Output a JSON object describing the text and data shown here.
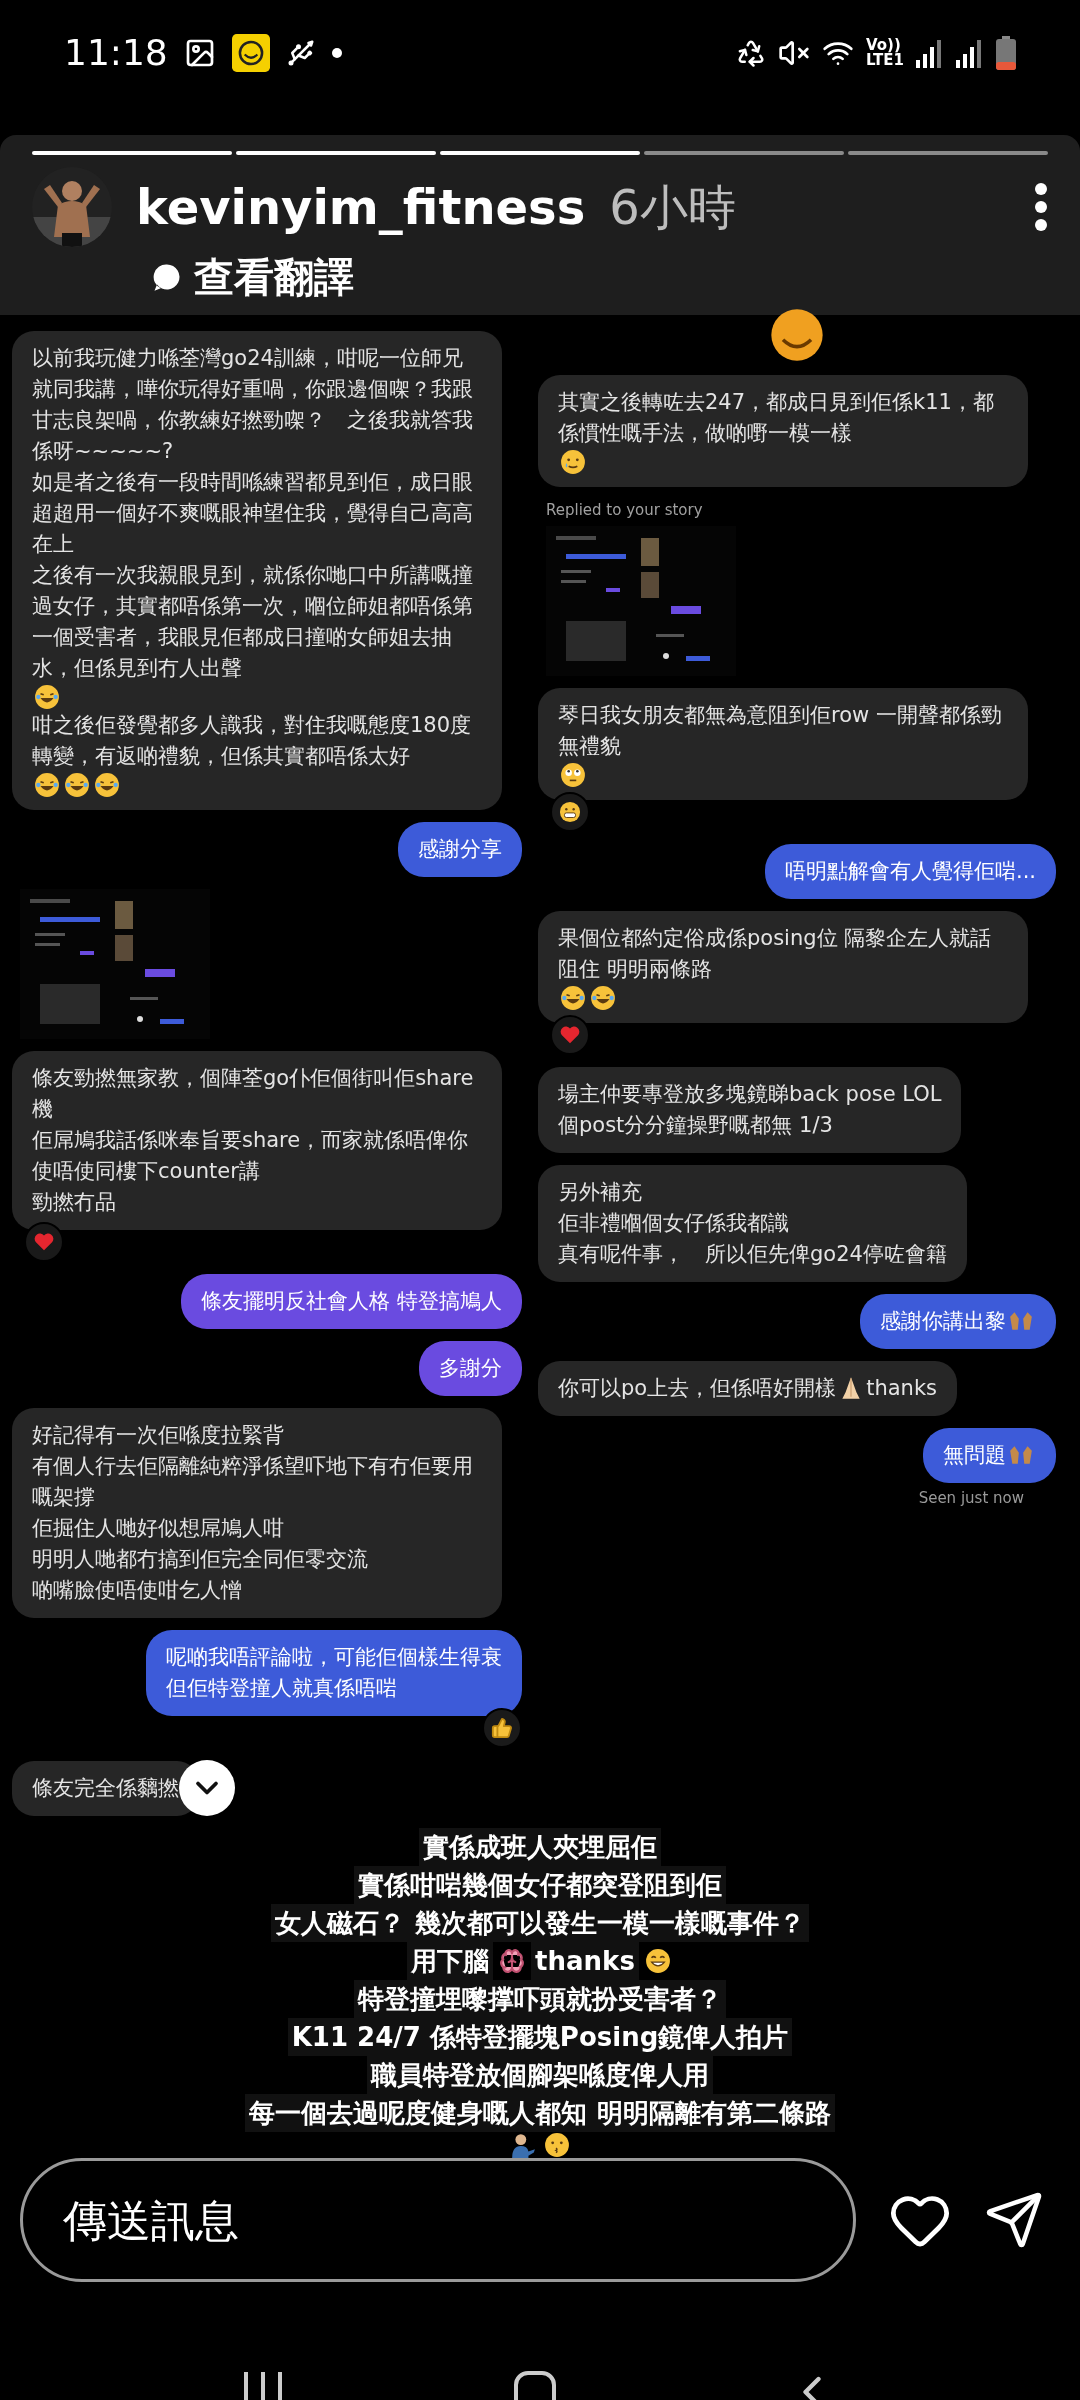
{
  "status_bar": {
    "time": "11:18",
    "network_top": "Vo))",
    "network_bottom": "LTE1"
  },
  "story": {
    "segments": [
      {
        "viewed": true
      },
      {
        "viewed": true
      },
      {
        "viewed": true
      },
      {
        "viewed": false
      },
      {
        "viewed": false
      }
    ],
    "username": "kevinyim_fitness",
    "time": "6小時",
    "translate": "查看翻譯"
  },
  "left_column": [
    {
      "kind": "message",
      "sent": false,
      "color": "#262626",
      "paragraphs": [
        [
          {
            "kind": "text",
            "text": "以前我玩健力喺荃灣go24訓練，咁呢一位師兄就同我講，嘩你玩得好重喎，你跟邊個㗎？我跟甘志良架喎，你教練好撚勁㗎？　之後我就答我係呀~~~~~?"
          }
        ],
        [
          {
            "kind": "text",
            "text": "如是者之後有一段時間喺練習都見到佢，成日眼超超用一個好不爽嘅眼神望住我，覺得自己高高在上"
          }
        ],
        [
          {
            "kind": "text",
            "text": "之後有一次我親眼見到，就係你哋口中所講嘅撞過女仔，其實都唔係第一次，嗰位師姐都唔係第一個受害者，我眼見佢都成日撞啲女師姐去抽水，但係見到冇人出聲"
          },
          {
            "kind": "laugh"
          }
        ],
        [
          {
            "kind": "text",
            "text": "咁之後佢發覺都多人識我，對住我嘅態度180度轉變，有返啲禮貌，但係其實都唔係太好"
          },
          {
            "kind": "laugh"
          },
          {
            "kind": "laugh"
          },
          {
            "kind": "laugh"
          }
        ]
      ]
    },
    {
      "kind": "message",
      "sent": true,
      "color": "#3d5bd9",
      "paragraphs": [
        [
          {
            "kind": "text",
            "text": "感謝分享"
          }
        ]
      ]
    },
    {
      "kind": "screenshot"
    },
    {
      "kind": "message",
      "sent": false,
      "color": "#262626",
      "reaction": {
        "kind": "heart"
      },
      "paragraphs": [
        [
          {
            "kind": "text",
            "text": "條友勁撚無家教，個陣荃go仆佢個街叫佢share機"
          }
        ],
        [
          {
            "kind": "text",
            "text": "佢屌鳩我話係咪奉旨要share，而家就係唔俾你使唔使同樓下counter講"
          }
        ],
        [
          {
            "kind": "text",
            "text": "勁撚冇品"
          }
        ]
      ]
    },
    {
      "kind": "message",
      "sent": true,
      "color": "#6a4be0",
      "paragraphs": [
        [
          {
            "kind": "text",
            "text": "條友擺明反社會人格 特登搞鳩人"
          }
        ]
      ]
    },
    {
      "kind": "message",
      "sent": true,
      "color": "#6a4be0",
      "paragraphs": [
        [
          {
            "kind": "text",
            "text": "多謝分"
          }
        ]
      ]
    },
    {
      "kind": "message",
      "sent": false,
      "color": "#262626",
      "paragraphs": [
        [
          {
            "kind": "text",
            "text": "好記得有一次佢喺度拉緊背"
          }
        ],
        [
          {
            "kind": "text",
            "text": "有個人行去佢隔離純粹淨係望吓地下有冇佢要用嘅架撐"
          }
        ],
        [
          {
            "kind": "text",
            "text": "佢掘住人哋好似想屌鳩人咁"
          }
        ],
        [
          {
            "kind": "text",
            "text": "明明人哋都冇搞到佢完全同佢零交流"
          }
        ],
        [
          {
            "kind": "text",
            "text": "啲嘴臉使唔使咁乞人憎"
          }
        ]
      ]
    },
    {
      "kind": "message",
      "sent": true,
      "color": "#3d5bd9",
      "reaction": {
        "kind": "thumbs"
      },
      "paragraphs": [
        [
          {
            "kind": "text",
            "text": "呢啲我唔評論啦，可能佢個樣生得衰"
          }
        ],
        [
          {
            "kind": "text",
            "text": "但佢特登撞人就真係唔啱"
          }
        ]
      ]
    },
    {
      "kind": "message",
      "sent": false,
      "color": "#262626",
      "scroll_button": true,
      "paragraphs": [
        [
          {
            "kind": "text",
            "text": "條友完全係黐撚"
          }
        ]
      ]
    }
  ],
  "right_column": [
    {
      "kind": "face"
    },
    {
      "kind": "message",
      "sent": false,
      "color": "#262626",
      "paragraphs": [
        [
          {
            "kind": "text",
            "text": "其實之後轉咗去247，都成日見到佢係k11，都係慣性嘅手法，做啲嘢一模一樣"
          },
          {
            "kind": "tear"
          }
        ]
      ]
    },
    {
      "kind": "screenshot",
      "label": "Replied to your story"
    },
    {
      "kind": "message",
      "sent": false,
      "color": "#262626",
      "reaction": {
        "kind": "grimace"
      },
      "paragraphs": [
        [
          {
            "kind": "text",
            "text": "琴日我女朋友都無為意阻到佢row 一開聲都係勁無禮貌"
          },
          {
            "kind": "eyeroll"
          }
        ]
      ]
    },
    {
      "kind": "message",
      "sent": true,
      "color": "#3d5bd9",
      "paragraphs": [
        [
          {
            "kind": "text",
            "text": "唔明點解會有人覺得佢啱..."
          }
        ]
      ]
    },
    {
      "kind": "message",
      "sent": false,
      "color": "#262626",
      "reaction": {
        "kind": "heart"
      },
      "paragraphs": [
        [
          {
            "kind": "text",
            "text": "果個位都約定俗成係posing位 隔黎企左人就話阻住 明明兩條路"
          },
          {
            "kind": "laugh"
          },
          {
            "kind": "laugh"
          }
        ]
      ]
    },
    {
      "kind": "message",
      "sent": false,
      "color": "#262626",
      "paragraphs": [
        [
          {
            "kind": "text",
            "text": "場主仲要專登放多塊鏡睇back pose LOL"
          }
        ],
        [
          {
            "kind": "text",
            "text": "個post分分鐘操野嘅都無 1/3"
          }
        ]
      ]
    },
    {
      "kind": "message",
      "sent": false,
      "color": "#262626",
      "paragraphs": [
        [
          {
            "kind": "text",
            "text": "另外補充"
          }
        ],
        [
          {
            "kind": "text",
            "text": "佢非禮嗰個女仔係我都識"
          }
        ],
        [
          {
            "kind": "text",
            "text": "真有呢件事，　所以佢先俾go24停咗會籍"
          }
        ]
      ]
    },
    {
      "kind": "message",
      "sent": true,
      "color": "#3d5bd9",
      "paragraphs": [
        [
          {
            "kind": "text",
            "text": "感謝你講出黎"
          },
          {
            "kind": "hands"
          }
        ]
      ]
    },
    {
      "kind": "message",
      "sent": false,
      "color": "#262626",
      "paragraphs": [
        [
          {
            "kind": "text",
            "text": "你可以po上去，但係唔好開樣"
          },
          {
            "kind": "pray"
          },
          {
            "kind": "text",
            "text": "thanks"
          }
        ]
      ]
    },
    {
      "kind": "message",
      "sent": true,
      "color": "#3d5bd9",
      "status": "Seen just now",
      "paragraphs": [
        [
          {
            "kind": "text",
            "text": "無問題"
          },
          {
            "kind": "hands"
          }
        ]
      ]
    }
  ],
  "caption": [
    [
      {
        "kind": "text",
        "text": "實係成班人夾埋屈佢"
      }
    ],
    [
      {
        "kind": "text",
        "text": "實係咁啱幾個女仔都突登阻到佢"
      }
    ],
    [
      {
        "kind": "text",
        "text": "女人磁石？ 幾次都可以發生一模一樣嘅事件？"
      }
    ],
    [
      {
        "kind": "text",
        "text": "用下腦"
      },
      {
        "kind": "brain"
      },
      {
        "kind": "text",
        "text": "thanks"
      },
      {
        "kind": "grin"
      }
    ],
    [
      {
        "kind": "text",
        "text": "特登撞埋嚟撑吓頭就扮受害者？"
      }
    ],
    [
      {
        "kind": "text",
        "text": "K11 24/7 係特登擺塊Posing鏡俾人拍片"
      }
    ],
    [
      {
        "kind": "text",
        "text": "職員特登放個腳架喺度俾人用"
      }
    ],
    [
      {
        "kind": "text",
        "text": "每一個去過呢度健身嘅人都知 明明隔離有第二條路"
      }
    ],
    [
      {
        "kind": "person"
      },
      {
        "kind": "kiss"
      }
    ]
  ],
  "composer": {
    "placeholder": "傳送訊息"
  }
}
